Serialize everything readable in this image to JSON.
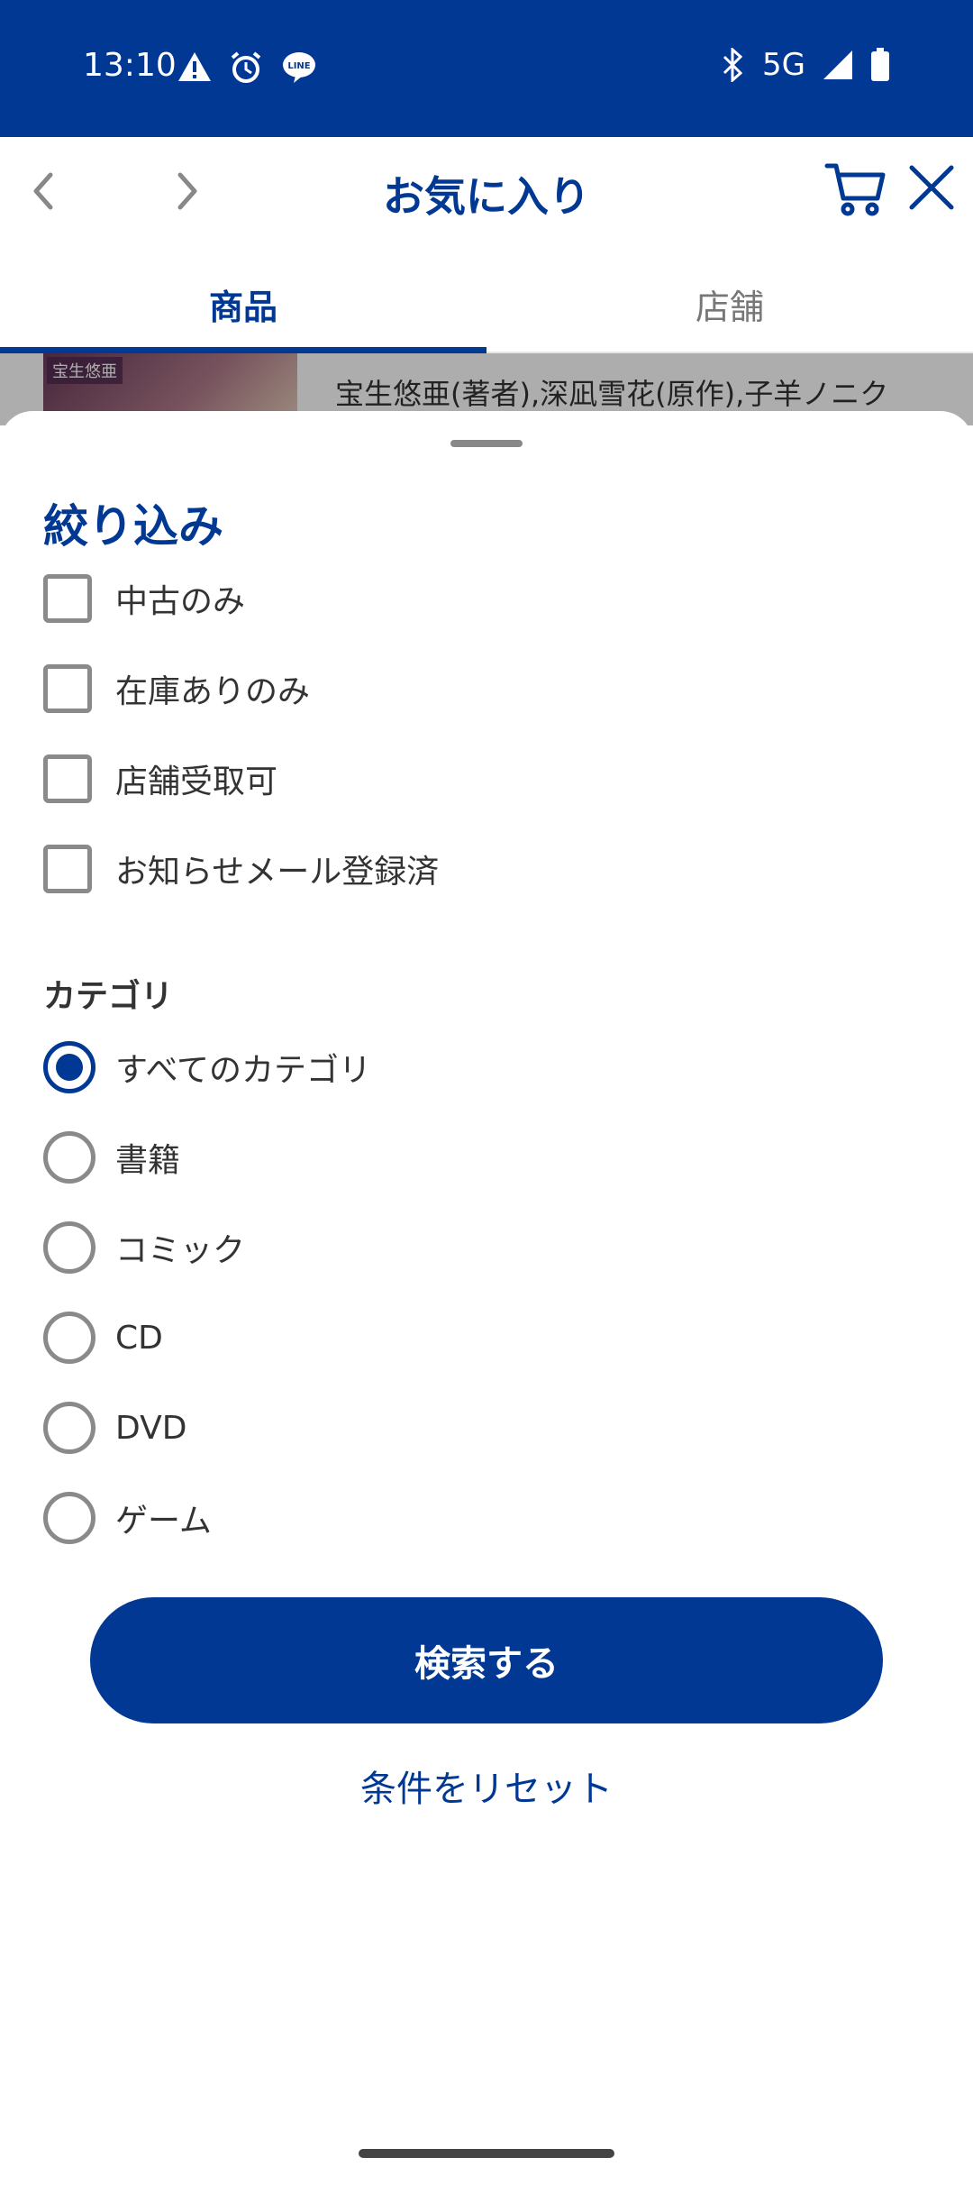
{
  "status": {
    "time": "13:10",
    "network": "5G",
    "icons": [
      "warning-icon",
      "alarm-icon",
      "line-app-icon",
      "bluetooth-icon",
      "signal-icon",
      "battery-icon"
    ]
  },
  "appbar": {
    "title": "お気に入り"
  },
  "tabs": [
    {
      "label": "商品",
      "active": true
    },
    {
      "label": "店舗",
      "active": false
    }
  ],
  "background_item": {
    "thumb_tag": "宝生悠亜",
    "authors": "宝生悠亜(著者),深凪雪花(原作),子羊ノニク"
  },
  "filter_sheet": {
    "title": "絞り込み",
    "checkboxes": [
      {
        "label": "中古のみ",
        "checked": false
      },
      {
        "label": "在庫ありのみ",
        "checked": false
      },
      {
        "label": "店舗受取可",
        "checked": false
      },
      {
        "label": "お知らせメール登録済",
        "checked": false
      }
    ],
    "category_label": "カテゴリ",
    "categories": [
      {
        "label": "すべてのカテゴリ",
        "selected": true
      },
      {
        "label": "書籍",
        "selected": false
      },
      {
        "label": "コミック",
        "selected": false
      },
      {
        "label": "CD",
        "selected": false
      },
      {
        "label": "DVD",
        "selected": false
      },
      {
        "label": "ゲーム",
        "selected": false
      }
    ],
    "search_button": "検索する",
    "reset_link": "条件をリセット"
  },
  "colors": {
    "brand": "#003894",
    "checkbox_border": "#8a8a8a"
  }
}
